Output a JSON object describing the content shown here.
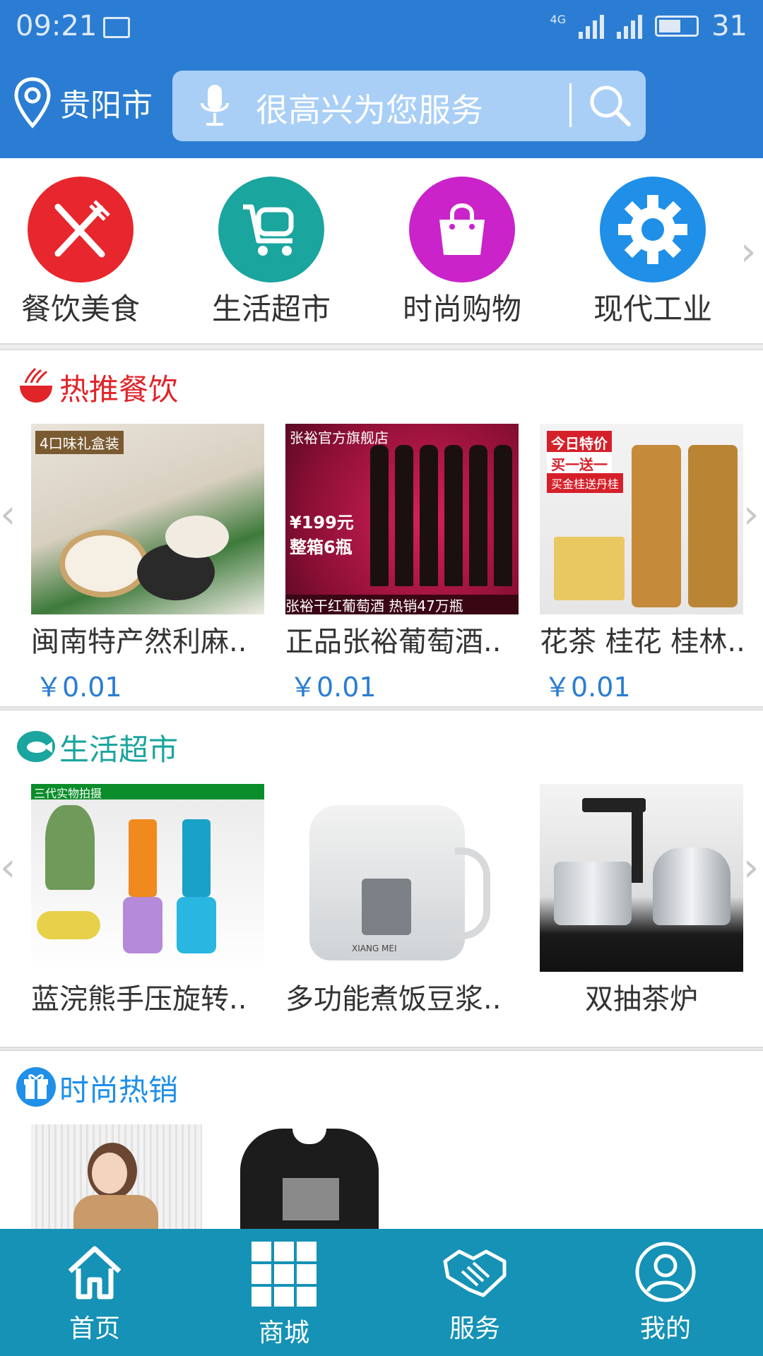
{
  "status": {
    "time": "09:21",
    "network": "4G",
    "battery": "31"
  },
  "header": {
    "city": "贵阳市",
    "search_placeholder": "很高兴为您服务"
  },
  "categories": [
    {
      "label": "餐饮美食",
      "color": "#e8262d",
      "icon": "fork-knife-icon"
    },
    {
      "label": "生活超市",
      "color": "#1aa59e",
      "icon": "cart-icon"
    },
    {
      "label": "时尚购物",
      "color": "#c923c9",
      "icon": "bag-icon"
    },
    {
      "label": "现代工业",
      "color": "#1f8fe8",
      "icon": "gear-icon"
    }
  ],
  "sections": [
    {
      "title": "热推餐饮",
      "title_color": "#e0242a",
      "products": [
        {
          "name": "闽南特产然利麻..",
          "price": "￥0.01",
          "overlay": "4口味礼盒装"
        },
        {
          "name": "正品张裕葡萄酒..",
          "price": "￥0.01",
          "overlay": "张裕官方旗舰店",
          "overlay2": "¥199元 整箱6瓶",
          "overlay3": "张裕干红葡萄酒 热销47万瓶"
        },
        {
          "name": "花茶 桂花 桂林..",
          "price": "￥0.01",
          "overlay": "今日特价",
          "overlay2": "买一送一",
          "overlay3": "买金桂送丹桂"
        }
      ]
    },
    {
      "title": "生活超市",
      "title_color": "#1aa59e",
      "products": [
        {
          "name": "蓝浣熊手压旋转..",
          "overlay": "三代实物拍摄"
        },
        {
          "name": "多功能煮饭豆浆..",
          "overlay": "XIANG MEI"
        },
        {
          "name": "双抽茶炉"
        }
      ]
    },
    {
      "title": "时尚热销",
      "title_color": "#1f8fe8"
    }
  ],
  "nav": [
    {
      "label": "首页"
    },
    {
      "label": "商城"
    },
    {
      "label": "服务"
    },
    {
      "label": "我的"
    }
  ]
}
